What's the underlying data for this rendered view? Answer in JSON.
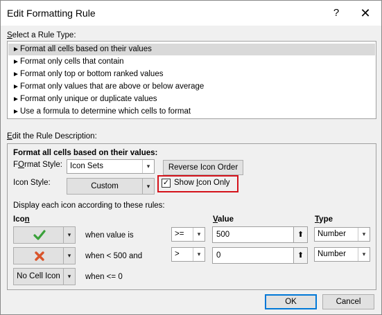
{
  "window": {
    "title": "Edit Formatting Rule",
    "help": "?",
    "close": "✕"
  },
  "rule_type": {
    "label_prefix": "",
    "label_accel": "S",
    "label_rest": "elect a Rule Type:",
    "arrow": "►",
    "items": [
      "Format all cells based on their values",
      "Format only cells that contain",
      "Format only top or bottom ranked values",
      "Format only values that are above or below average",
      "Format only unique or duplicate values",
      "Use a formula to determine which cells to format"
    ]
  },
  "description": {
    "label_accel": "E",
    "label_rest": "dit the Rule Description:",
    "heading": "Format all cells based on their values:",
    "format_style_accel": "O",
    "format_style_pre": "F",
    "format_style_rest": "rmat Style:",
    "format_style_value": "Icon Sets",
    "reverse_label": "Reverse Icon Order",
    "icon_style_label": "Icon Style:",
    "icon_style_value": "Custom",
    "show_icon_only_accel": "I",
    "show_icon_only_pre": "Show ",
    "show_icon_only_rest": "con Only",
    "show_icon_only_checked": true,
    "rules_intro": "Display each icon according to these rules:",
    "col_icon_pre": "Ico",
    "col_icon_accel": "n",
    "col_value_accel": "V",
    "col_value_rest": "alue",
    "col_type_accel": "T",
    "col_type_rest": "ype",
    "rows": [
      {
        "icon": "green-checkmark-icon",
        "text": "when value is",
        "operator": ">=",
        "value": "500",
        "type": "Number"
      },
      {
        "icon": "red-x-icon",
        "text": "when < 500 and",
        "operator": ">",
        "value": "0",
        "type": "Number"
      },
      {
        "icon": "no-cell-icon",
        "icon_label": "No Cell Icon",
        "text": "when <= 0"
      }
    ]
  },
  "footer": {
    "ok": "OK",
    "cancel": "Cancel"
  },
  "colors": {
    "highlight": "#d4111a",
    "check_green": "#3aa13a",
    "x_red": "#d9542b",
    "ok_border": "#0078d7"
  }
}
